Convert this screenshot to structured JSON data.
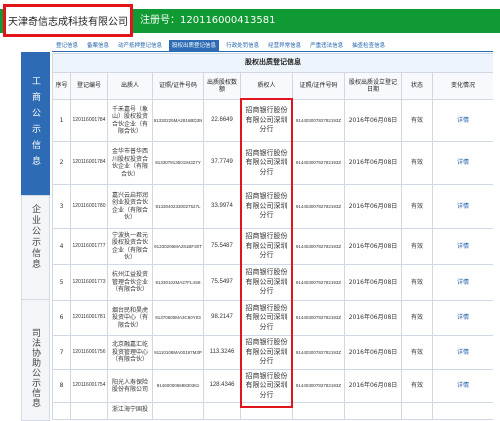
{
  "header": {
    "company_name": "天津奇信志成科技有限公司",
    "reg_label": "注册号：",
    "reg_no": "120116000413581"
  },
  "tabs": [
    {
      "label": "登记信息"
    },
    {
      "label": "备案信息"
    },
    {
      "label": "动产抵押登记信息"
    },
    {
      "label": "股权出质登记信息",
      "active": true
    },
    {
      "label": "行政处罚信息"
    },
    {
      "label": "经营异常信息"
    },
    {
      "label": "严重违法信息"
    },
    {
      "label": "抽查检查信息"
    }
  ],
  "sidebar": {
    "items": [
      {
        "label": "工商公示信息",
        "active": true
      },
      {
        "label": "企业公示信息"
      },
      {
        "label": "司法协助公示信息"
      }
    ]
  },
  "table": {
    "caption": "股权出质登记信息",
    "columns": [
      "序号",
      "登记编号",
      "出质人",
      "证照/证件号码",
      "出质股权数额",
      "质权人",
      "证照/证件号码",
      "股权出质设立登记日期",
      "状态",
      "变化情况"
    ],
    "rows": [
      {
        "index": "1",
        "reg_no": "120116001784",
        "pledgor": "千禾嘉号（象山）股权投资合伙企业（有限合伙）",
        "pledgor_cert": "91330225MA2816BD3N",
        "amount": "22.6649",
        "pledgee": "招商银行股份有限公司深圳分行",
        "pledgee_cert": "91440300782782193Z",
        "date": "2016年06月08日",
        "status": "有效",
        "detail": "详情"
      },
      {
        "index": "2",
        "reg_no": "120116001784",
        "pledgor": "金华市普华西川股权投资合伙企业（有限合伙）",
        "pledgor_cert": "91330781350194327Y",
        "amount": "37.7749",
        "pledgee": "招商银行股份有限公司深圳分行",
        "pledgee_cert": "91440300782782193Z",
        "date": "2016年06月08日",
        "status": "有效",
        "detail": "详情"
      },
      {
        "index": "3",
        "reg_no": "120116001780",
        "pledgor": "嘉兴云启邦润创业投资合伙企业（有限合伙）",
        "pledgor_cert": "91330402330027527L",
        "amount": "33.9974",
        "pledgee": "招商银行股份有限公司深圳分行",
        "pledgee_cert": "91440300782782193Z",
        "date": "2016年06月08日",
        "status": "有效",
        "detail": "详情"
      },
      {
        "index": "4",
        "reg_no": "120116001777",
        "pledgor": "宁波执一君元股权投资合伙企业（有限合伙）",
        "pledgor_cert": "91330206MA281BF30T",
        "amount": "75.5487",
        "pledgee": "招商银行股份有限公司深圳分行",
        "pledgee_cert": "91440300782782193Z",
        "date": "2016年06月08日",
        "status": "有效",
        "detail": "详情"
      },
      {
        "index": "5",
        "reg_no": "120116001773",
        "pledgor": "杭州江益投资管理合伙企业（有限合伙）",
        "pledgor_cert": "91330102MA27FL4S8",
        "amount": "75.5497",
        "pledgee": "招商银行股份有限公司深圳分行",
        "pledgee_cert": "91440300782782193Z",
        "date": "2016年06月08日",
        "status": "有效",
        "detail": "详情"
      },
      {
        "index": "6",
        "reg_no": "120116001781",
        "pledgor": "烟台民和昊虎投资中心（有限合伙）",
        "pledgor_cert": "91370600MA3C60Y03",
        "amount": "98.2147",
        "pledgee": "招商银行股份有限公司深圳分行",
        "pledgee_cert": "91440300782782193Z",
        "date": "2016年06月08日",
        "status": "有效",
        "detail": "详情"
      },
      {
        "index": "7",
        "reg_no": "120116001756",
        "pledgor": "北京融嘉汇屹投资管理中心（有限合伙）",
        "pledgor_cert": "91110108MA00197M3P",
        "amount": "113.3246",
        "pledgee": "招商银行股份有限公司深圳分行",
        "pledgee_cert": "91440300782782193Z",
        "date": "2016年06月08日",
        "status": "有效",
        "detail": "详情"
      },
      {
        "index": "8",
        "reg_no": "120116001754",
        "pledgor": "阳光人寿保险股份有限公司",
        "pledgor_cert": "91460000669830361",
        "amount": "128.4346",
        "pledgee": "招商银行股份有限公司深圳分行",
        "pledgee_cert": "91440300782782193Z",
        "date": "2016年06月08日",
        "status": "有效",
        "detail": "详情"
      },
      {
        "pledgor": "浙江海宁国投"
      }
    ]
  },
  "colors": {
    "header_green": "#0f9a33",
    "highlight_red": "#e2141c",
    "accent_blue": "#2d6cb4",
    "link_blue": "#1d5ea9"
  }
}
